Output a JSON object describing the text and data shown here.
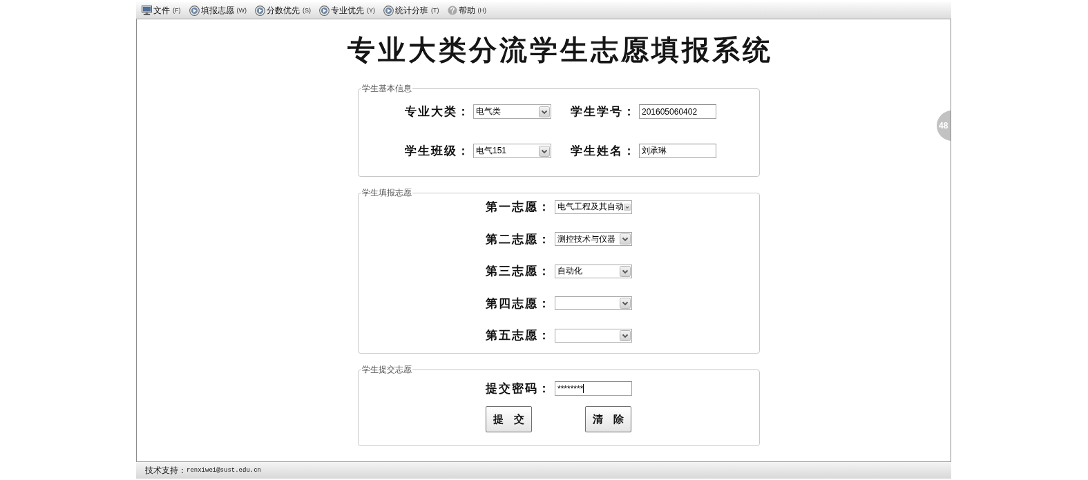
{
  "menu_bar": {
    "items": [
      {
        "kind": "file",
        "label": "文件",
        "accel": "(F)"
      },
      {
        "kind": "action",
        "label": "填报志愿",
        "accel": "(W)"
      },
      {
        "kind": "action",
        "label": "分数优先",
        "accel": "(S)"
      },
      {
        "kind": "action",
        "label": "专业优先",
        "accel": "(Y)"
      },
      {
        "kind": "action",
        "label": "统计分班",
        "accel": "(T)"
      },
      {
        "kind": "help",
        "label": "帮助",
        "accel": "(H)"
      }
    ]
  },
  "title": "专业大类分流学生志愿填报系统",
  "basic_info": {
    "legend": "学生基本信息",
    "fields": [
      {
        "kind": "select",
        "label": "专业大类：",
        "value": "电气类"
      },
      {
        "kind": "input",
        "label": "学生学号：",
        "value": "201605060402"
      },
      {
        "kind": "select",
        "label": "学生班级：",
        "value": "电气151"
      },
      {
        "kind": "input",
        "label": "学生姓名：",
        "value": "刘承琳"
      }
    ]
  },
  "preferences": {
    "legend": "学生填报志愿",
    "choices": [
      {
        "label": "第一志愿：",
        "value": "电气工程及其自动"
      },
      {
        "label": "第二志愿：",
        "value": "测控技术与仪器"
      },
      {
        "label": "第三志愿：",
        "value": "自动化"
      },
      {
        "label": "第四志愿："
      },
      {
        "label": "第五志愿："
      }
    ]
  },
  "submit": {
    "legend": "学生提交志愿",
    "password": {
      "label": "提交密码：",
      "value": "********",
      "focused": true
    },
    "buttons": [
      {
        "label": "提　交"
      },
      {
        "label": "清　除"
      }
    ]
  },
  "side_badge": "48",
  "status_bar": {
    "label": "技术支持：",
    "email": "renxiwei@sust.edu.cn"
  }
}
